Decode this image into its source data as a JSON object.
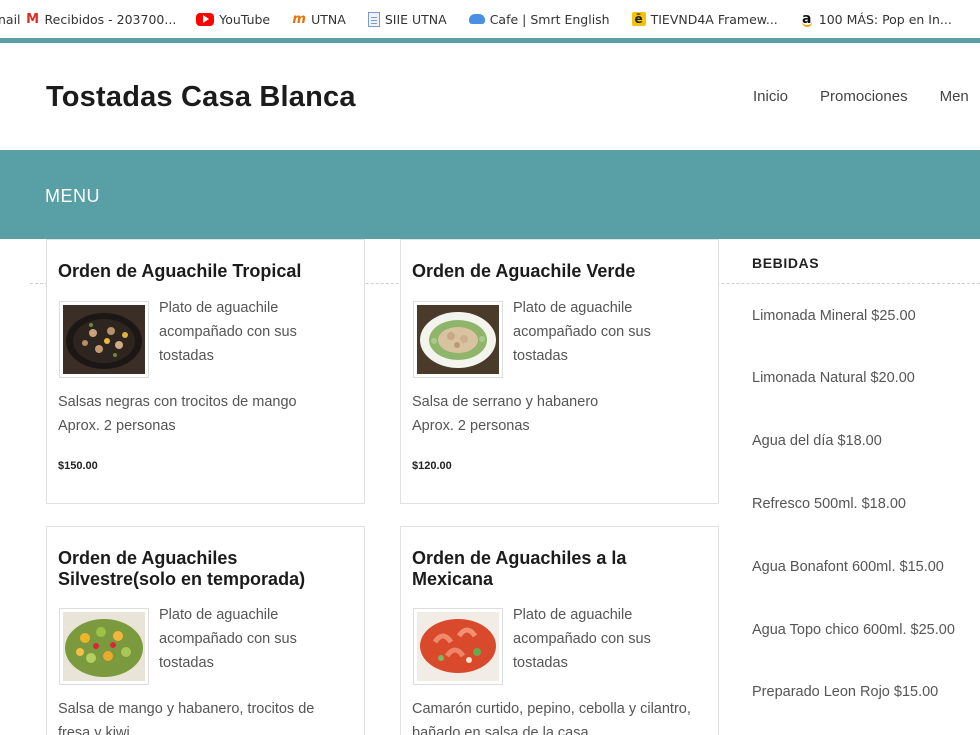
{
  "bookmarks": [
    {
      "label": "Recibidos - 203700...",
      "icon": "gmail-icon",
      "prefix": "nail"
    },
    {
      "label": "YouTube",
      "icon": "youtube-icon"
    },
    {
      "label": "UTNA",
      "icon": "utna-icon"
    },
    {
      "label": "SIIE UTNA",
      "icon": "document-icon"
    },
    {
      "label": "Cafe | Smrt English",
      "icon": "cloud-icon"
    },
    {
      "label": "TIEVND4A Framew...",
      "icon": "tievnd-icon"
    },
    {
      "label": "100 MÁS: Pop en In...",
      "icon": "amazon-icon"
    }
  ],
  "site": {
    "title": "Tostadas Casa Blanca",
    "nav": [
      "Inicio",
      "Promociones",
      "Men"
    ]
  },
  "band": {
    "label": "MENU"
  },
  "cards": [
    {
      "title": "Orden de Aguachile Tropical",
      "description": "Plato de aguachile acompañado con sus tostadas",
      "detail_lines": [
        "Salsas negras con trocitos de mango",
        "Aprox. 2 personas"
      ],
      "price": "$150.00",
      "image": "dark-aguachile-photo"
    },
    {
      "title": "Orden de Aguachile Verde",
      "description": "Plato de aguachile acompañado con sus tostadas",
      "detail_lines": [
        "Salsa de serrano y habanero",
        "Aprox. 2 personas"
      ],
      "price": "$120.00",
      "image": "green-aguachile-photo"
    },
    {
      "title": "Orden de Aguachiles Silvestre(solo en temporada)",
      "description": "Plato de aguachile acompañado con sus tostadas",
      "detail_lines": [
        "Salsa de mango y habanero, trocitos de",
        "fresa y kiwi"
      ],
      "price": "",
      "image": "mango-aguachile-photo"
    },
    {
      "title": "Orden de Aguachiles a la Mexicana",
      "description": "Plato de aguachile acompañado con sus tostadas",
      "detail_lines": [
        "Camarón curtido, pepino, cebolla y cilantro,",
        "bañado en salsa de la casa"
      ],
      "price": "",
      "image": "shrimp-aguachile-photo"
    }
  ],
  "drinks": {
    "title": "BEBIDAS",
    "items": [
      "Limonada Mineral $25.00",
      "Limonada Natural $20.00",
      "Agua del día $18.00",
      "Refresco 500ml. $18.00",
      "Agua Bonafont 600ml. $15.00",
      "Agua Topo chico 600ml. $25.00",
      "Preparado Leon Rojo $15.00"
    ]
  },
  "colors": {
    "accent": "#58a0a5",
    "rule": "#5a9ea6"
  }
}
